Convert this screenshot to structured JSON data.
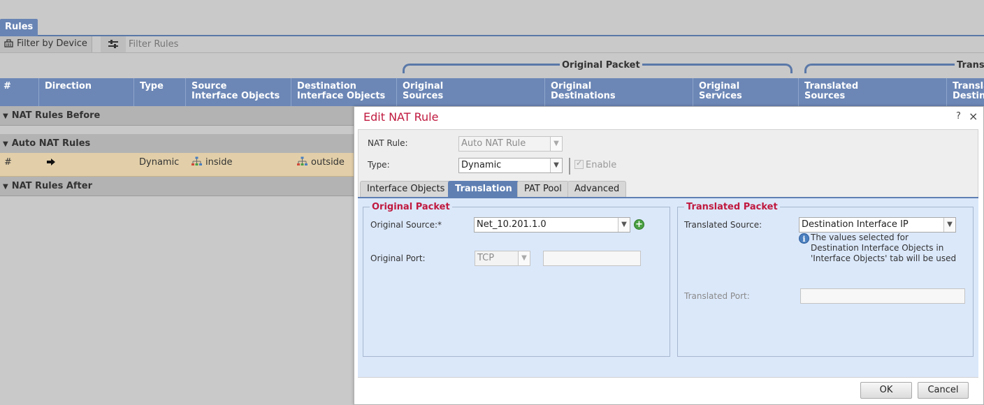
{
  "rules_page": {
    "tab_label": "Rules",
    "filter_by_device": "Filter by Device",
    "filter_placeholder": "Filter Rules",
    "group_original": "Original Packet",
    "group_translated": "Trans",
    "columns": [
      "#",
      "Direction",
      "Type",
      "Source\nInterface Objects",
      "Destination\nInterface Objects",
      "Original\nSources",
      "Original\nDestinations",
      "Original\nServices",
      "Translated\nSources",
      "Transla\nDestin"
    ],
    "sections": {
      "before": "NAT Rules Before",
      "auto": "Auto NAT Rules",
      "after": "NAT Rules After"
    },
    "row": {
      "num": "#",
      "direction_icon": "arrow-right-icon",
      "type": "Dynamic",
      "source_interface": "inside",
      "destination_interface": "outside"
    }
  },
  "dialog": {
    "title": "Edit NAT Rule",
    "help": "?",
    "close": "×",
    "nat_rule_label": "NAT Rule:",
    "nat_rule_value": "Auto NAT Rule",
    "type_label": "Type:",
    "type_value": "Dynamic",
    "enable_label": "Enable",
    "enable_checked": true,
    "tabs": [
      "Interface Objects",
      "Translation",
      "PAT Pool",
      "Advanced"
    ],
    "active_tab": "Translation",
    "original_packet": {
      "legend": "Original Packet",
      "source_label": "Original Source:*",
      "source_value": "Net_10.201.1.0",
      "port_label": "Original Port:",
      "port_protocol": "TCP",
      "port_value": ""
    },
    "translated_packet": {
      "legend": "Translated Packet",
      "source_label": "Translated Source:",
      "source_value": "Destination Interface IP",
      "info_text": "The values selected for\nDestination Interface Objects in\n'Interface Objects' tab will be used",
      "port_label": "Translated Port:",
      "port_value": ""
    },
    "ok_label": "OK",
    "cancel_label": "Cancel"
  },
  "colors": {
    "accent_blue": "#5f7fb3",
    "title_red": "#c0193f",
    "row_highlight": "#e2cfa9"
  }
}
